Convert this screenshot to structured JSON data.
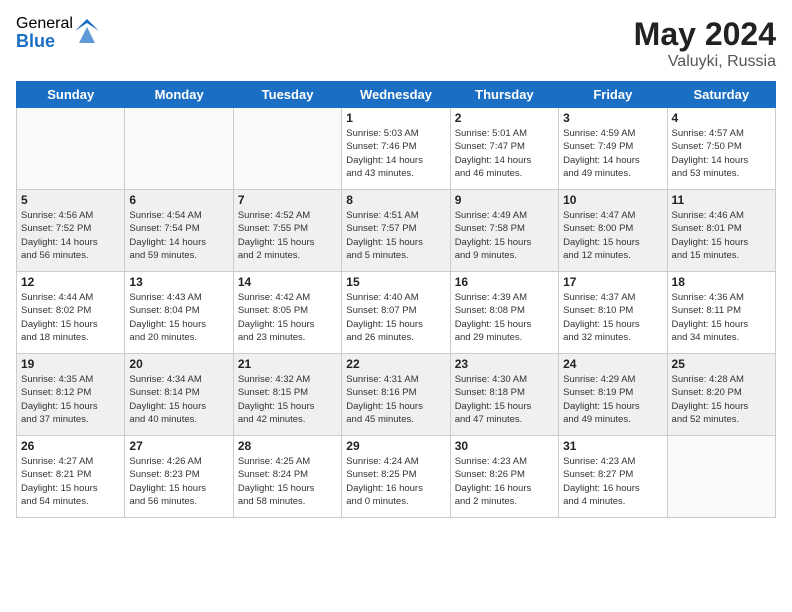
{
  "logo": {
    "general": "General",
    "blue": "Blue"
  },
  "header": {
    "month_year": "May 2024",
    "location": "Valuyki, Russia"
  },
  "days_of_week": [
    "Sunday",
    "Monday",
    "Tuesday",
    "Wednesday",
    "Thursday",
    "Friday",
    "Saturday"
  ],
  "weeks": [
    [
      {
        "day": "",
        "info": ""
      },
      {
        "day": "",
        "info": ""
      },
      {
        "day": "",
        "info": ""
      },
      {
        "day": "1",
        "info": "Sunrise: 5:03 AM\nSunset: 7:46 PM\nDaylight: 14 hours\nand 43 minutes."
      },
      {
        "day": "2",
        "info": "Sunrise: 5:01 AM\nSunset: 7:47 PM\nDaylight: 14 hours\nand 46 minutes."
      },
      {
        "day": "3",
        "info": "Sunrise: 4:59 AM\nSunset: 7:49 PM\nDaylight: 14 hours\nand 49 minutes."
      },
      {
        "day": "4",
        "info": "Sunrise: 4:57 AM\nSunset: 7:50 PM\nDaylight: 14 hours\nand 53 minutes."
      }
    ],
    [
      {
        "day": "5",
        "info": "Sunrise: 4:56 AM\nSunset: 7:52 PM\nDaylight: 14 hours\nand 56 minutes."
      },
      {
        "day": "6",
        "info": "Sunrise: 4:54 AM\nSunset: 7:54 PM\nDaylight: 14 hours\nand 59 minutes."
      },
      {
        "day": "7",
        "info": "Sunrise: 4:52 AM\nSunset: 7:55 PM\nDaylight: 15 hours\nand 2 minutes."
      },
      {
        "day": "8",
        "info": "Sunrise: 4:51 AM\nSunset: 7:57 PM\nDaylight: 15 hours\nand 5 minutes."
      },
      {
        "day": "9",
        "info": "Sunrise: 4:49 AM\nSunset: 7:58 PM\nDaylight: 15 hours\nand 9 minutes."
      },
      {
        "day": "10",
        "info": "Sunrise: 4:47 AM\nSunset: 8:00 PM\nDaylight: 15 hours\nand 12 minutes."
      },
      {
        "day": "11",
        "info": "Sunrise: 4:46 AM\nSunset: 8:01 PM\nDaylight: 15 hours\nand 15 minutes."
      }
    ],
    [
      {
        "day": "12",
        "info": "Sunrise: 4:44 AM\nSunset: 8:02 PM\nDaylight: 15 hours\nand 18 minutes."
      },
      {
        "day": "13",
        "info": "Sunrise: 4:43 AM\nSunset: 8:04 PM\nDaylight: 15 hours\nand 20 minutes."
      },
      {
        "day": "14",
        "info": "Sunrise: 4:42 AM\nSunset: 8:05 PM\nDaylight: 15 hours\nand 23 minutes."
      },
      {
        "day": "15",
        "info": "Sunrise: 4:40 AM\nSunset: 8:07 PM\nDaylight: 15 hours\nand 26 minutes."
      },
      {
        "day": "16",
        "info": "Sunrise: 4:39 AM\nSunset: 8:08 PM\nDaylight: 15 hours\nand 29 minutes."
      },
      {
        "day": "17",
        "info": "Sunrise: 4:37 AM\nSunset: 8:10 PM\nDaylight: 15 hours\nand 32 minutes."
      },
      {
        "day": "18",
        "info": "Sunrise: 4:36 AM\nSunset: 8:11 PM\nDaylight: 15 hours\nand 34 minutes."
      }
    ],
    [
      {
        "day": "19",
        "info": "Sunrise: 4:35 AM\nSunset: 8:12 PM\nDaylight: 15 hours\nand 37 minutes."
      },
      {
        "day": "20",
        "info": "Sunrise: 4:34 AM\nSunset: 8:14 PM\nDaylight: 15 hours\nand 40 minutes."
      },
      {
        "day": "21",
        "info": "Sunrise: 4:32 AM\nSunset: 8:15 PM\nDaylight: 15 hours\nand 42 minutes."
      },
      {
        "day": "22",
        "info": "Sunrise: 4:31 AM\nSunset: 8:16 PM\nDaylight: 15 hours\nand 45 minutes."
      },
      {
        "day": "23",
        "info": "Sunrise: 4:30 AM\nSunset: 8:18 PM\nDaylight: 15 hours\nand 47 minutes."
      },
      {
        "day": "24",
        "info": "Sunrise: 4:29 AM\nSunset: 8:19 PM\nDaylight: 15 hours\nand 49 minutes."
      },
      {
        "day": "25",
        "info": "Sunrise: 4:28 AM\nSunset: 8:20 PM\nDaylight: 15 hours\nand 52 minutes."
      }
    ],
    [
      {
        "day": "26",
        "info": "Sunrise: 4:27 AM\nSunset: 8:21 PM\nDaylight: 15 hours\nand 54 minutes."
      },
      {
        "day": "27",
        "info": "Sunrise: 4:26 AM\nSunset: 8:23 PM\nDaylight: 15 hours\nand 56 minutes."
      },
      {
        "day": "28",
        "info": "Sunrise: 4:25 AM\nSunset: 8:24 PM\nDaylight: 15 hours\nand 58 minutes."
      },
      {
        "day": "29",
        "info": "Sunrise: 4:24 AM\nSunset: 8:25 PM\nDaylight: 16 hours\nand 0 minutes."
      },
      {
        "day": "30",
        "info": "Sunrise: 4:23 AM\nSunset: 8:26 PM\nDaylight: 16 hours\nand 2 minutes."
      },
      {
        "day": "31",
        "info": "Sunrise: 4:23 AM\nSunset: 8:27 PM\nDaylight: 16 hours\nand 4 minutes."
      },
      {
        "day": "",
        "info": ""
      }
    ]
  ]
}
